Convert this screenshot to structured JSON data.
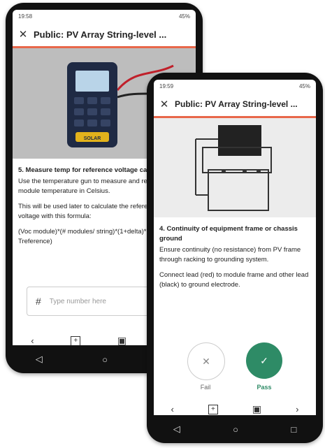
{
  "back_phone": {
    "status_time": "19:58",
    "status_right": "45%",
    "title": "Public: PV Array String-level ...",
    "step_title": "5. Measure temp for reference voltage calcs",
    "p1": "Use the temperature gun to measure and record the module temperature in Celsius.",
    "p2": "This will be used later to calculate the reference string voltage with this formula:",
    "p3": "(Voc module)*(# modules/ string)*(1+delta)*(Tmodule-Treference)",
    "input_placeholder": "Type number here",
    "input_prefix": "#",
    "device_label": "SOLAR"
  },
  "front_phone": {
    "status_time": "19:59",
    "status_right": "45%",
    "title": "Public: PV Array String-level ...",
    "step_title": "4. Continuity of equipment frame or chassis ground",
    "p1": "Ensure continuity (no resistance) from PV frame through racking to grounding system.",
    "p2": "Connect lead (red) to module frame and other lead (black) to ground electrode.",
    "fail_label": "Fail",
    "pass_label": "Pass"
  },
  "colors": {
    "accent": "#e8674a",
    "pass": "#2e8b66"
  },
  "icons": [
    "close-icon",
    "back-icon",
    "forward-icon",
    "add-image-icon",
    "camera-icon",
    "nav-back-icon",
    "nav-home-icon",
    "nav-recents-icon"
  ]
}
